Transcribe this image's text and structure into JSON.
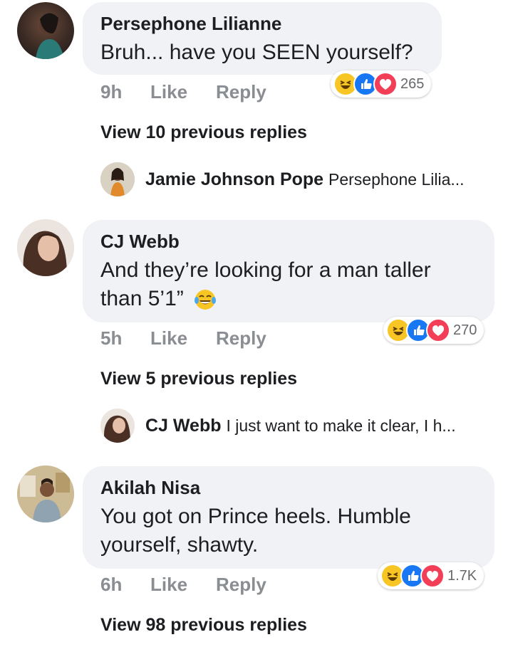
{
  "comments": [
    {
      "author": "Persephone Lilianne",
      "text": "Bruh... have you SEEN yourself?",
      "time": "9h",
      "like_label": "Like",
      "reply_label": "Reply",
      "reaction_count": "265",
      "reaction_icons": [
        "haha-icon",
        "like-icon",
        "love-icon"
      ],
      "view_replies": "View 10 previous replies",
      "latest_reply": {
        "author": "Jamie Johnson Pope",
        "text": "Persephone Lilia..."
      }
    },
    {
      "author": "CJ Webb",
      "text_line1": "And they’re looking for a man taller",
      "text_line2": "than 5’1”",
      "time": "5h",
      "like_label": "Like",
      "reply_label": "Reply",
      "reaction_count": "270",
      "reaction_icons": [
        "haha-icon",
        "like-icon",
        "love-icon"
      ],
      "view_replies": "View 5 previous replies",
      "latest_reply": {
        "author": "CJ Webb",
        "text": "I just want to make it clear, I h..."
      }
    },
    {
      "author": "Akilah Nisa",
      "text_line1": "You got on Prince heels. Humble",
      "text_line2": "yourself, shawty.",
      "time": "6h",
      "like_label": "Like",
      "reply_label": "Reply",
      "reaction_count": "1.7K",
      "reaction_icons": [
        "haha-icon",
        "like-icon",
        "love-icon"
      ],
      "view_replies": "View 98 previous replies"
    }
  ],
  "colors": {
    "bubble": "#f0f2f5",
    "meta": "#8a8d91",
    "like_blue": "#1877f2",
    "love_red": "#f33e58",
    "haha_yellow": "#f7c624"
  }
}
